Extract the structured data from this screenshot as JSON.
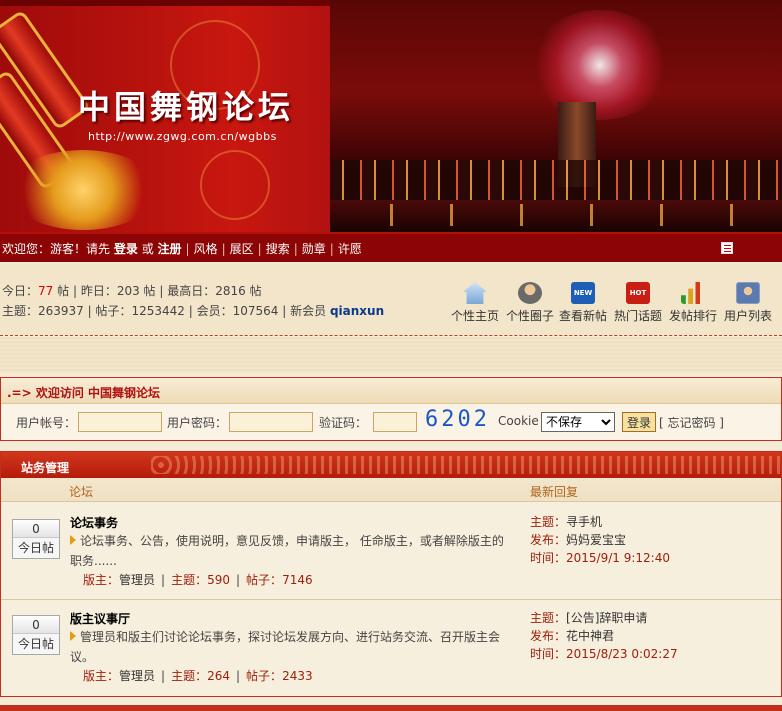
{
  "banner": {
    "logo_text": "中国舞钢论坛",
    "url": "http://www.zgwg.com.cn/wgbbs"
  },
  "nav": {
    "welcome": "欢迎您：游客！请先",
    "login": "登录",
    "or": "或",
    "register": "注册",
    "links": [
      "风格",
      "展区",
      "搜索",
      "勋章",
      "许愿"
    ]
  },
  "stats": {
    "today_label": "今日：",
    "today_value": "77",
    "today_unit": "帖",
    "yesterday": "昨日：203 帖",
    "highest": "最高日：2816 帖",
    "topics": "主题：263937",
    "posts": "帖子：1253442",
    "members": "会员：107564",
    "new_member_label": "新会员",
    "new_member": "qianxun"
  },
  "quick_links": [
    {
      "label": "个性主页",
      "icon": "home-icon"
    },
    {
      "label": "个性圈子",
      "icon": "people-icon"
    },
    {
      "label": "查看新帖",
      "icon": "new-icon"
    },
    {
      "label": "热门话题",
      "icon": "hot-icon"
    },
    {
      "label": "发帖排行",
      "icon": "chart-icon"
    },
    {
      "label": "用户列表",
      "icon": "user-list-icon"
    }
  ],
  "login": {
    "header": ".=> 欢迎访问 中国舞钢论坛",
    "username_label": "用户帐号：",
    "password_label": "用户密码：",
    "captcha_label": "验证码：",
    "captcha": "6202",
    "cookie_label": "Cookie",
    "cookie_selected": "不保存",
    "login_button": "登录",
    "forgot": "[ 忘记密码 ]"
  },
  "section": {
    "title": "站务管理",
    "col_forum": "论坛",
    "col_latest": "最新回复",
    "forums": [
      {
        "count": "0",
        "count_label": "今日帖",
        "name": "论坛事务",
        "desc": "论坛事务、公告，使用说明，意见反馈，申请版主， 任命版主，或者解除版主的职务......",
        "mod_label": "版主：",
        "mod": "管理员",
        "topics_label": "主题：",
        "topics": "590",
        "posts_label": "帖子：",
        "posts": "7146",
        "latest_topic_label": "主题：",
        "latest_topic": "寻手机",
        "latest_author_label": "发布：",
        "latest_author": "妈妈爱宝宝",
        "latest_time_label": "时间：",
        "latest_time": "2015/9/1 9:12:40"
      },
      {
        "count": "0",
        "count_label": "今日帖",
        "name": "版主议事厅",
        "desc": "管理员和版主们讨论论坛事务，探讨论坛发展方向、进行站务交流、召开版主会议。",
        "mod_label": "版主：",
        "mod": "管理员",
        "topics_label": "主题：",
        "topics": "264",
        "posts_label": "帖子：",
        "posts": "2433",
        "latest_topic_label": "主题：",
        "latest_topic": "[公告]辞职申请",
        "latest_author_label": "发布：",
        "latest_author": "花中神君",
        "latest_time_label": "时间：",
        "latest_time": "2015/8/23 0:02:27"
      }
    ]
  },
  "colors": {
    "nav_bg": "#8c0404",
    "accent_red": "#d00000",
    "section_title": "#c0301c",
    "captcha": "#1a58c8"
  }
}
